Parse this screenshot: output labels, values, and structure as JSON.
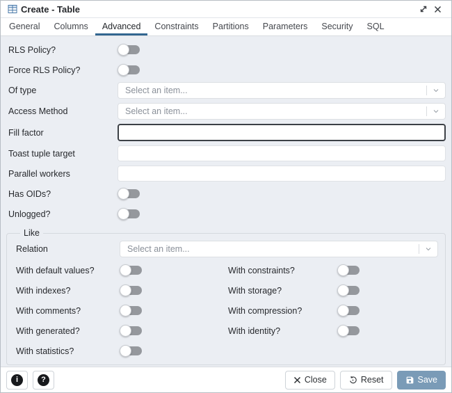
{
  "window": {
    "title": "Create - Table",
    "icon": "table-grid"
  },
  "tabs": {
    "items": [
      {
        "label": "General",
        "active": false
      },
      {
        "label": "Columns",
        "active": false
      },
      {
        "label": "Advanced",
        "active": true
      },
      {
        "label": "Constraints",
        "active": false
      },
      {
        "label": "Partitions",
        "active": false
      },
      {
        "label": "Parameters",
        "active": false
      },
      {
        "label": "Security",
        "active": false
      },
      {
        "label": "SQL",
        "active": false
      }
    ]
  },
  "form": {
    "rls_policy": {
      "label": "RLS Policy?",
      "type": "toggle",
      "value": false
    },
    "force_rls_policy": {
      "label": "Force RLS Policy?",
      "type": "toggle",
      "value": false
    },
    "of_type": {
      "label": "Of type",
      "type": "select",
      "placeholder": "Select an item..."
    },
    "access_method": {
      "label": "Access Method",
      "type": "select",
      "placeholder": "Select an item..."
    },
    "fill_factor": {
      "label": "Fill factor",
      "type": "text",
      "value": "",
      "focused": true
    },
    "toast_tuple_target": {
      "label": "Toast tuple target",
      "type": "text",
      "value": ""
    },
    "parallel_workers": {
      "label": "Parallel workers",
      "type": "text",
      "value": ""
    },
    "has_oids": {
      "label": "Has OIDs?",
      "type": "toggle",
      "value": false
    },
    "unlogged": {
      "label": "Unlogged?",
      "type": "toggle",
      "value": false
    }
  },
  "like_section": {
    "legend": "Like",
    "relation": {
      "label": "Relation",
      "type": "select",
      "placeholder": "Select an item..."
    },
    "toggles": [
      {
        "label": "With default values?",
        "value": false
      },
      {
        "label": "With constraints?",
        "value": false
      },
      {
        "label": "With indexes?",
        "value": false
      },
      {
        "label": "With storage?",
        "value": false
      },
      {
        "label": "With comments?",
        "value": false
      },
      {
        "label": "With compression?",
        "value": false
      },
      {
        "label": "With generated?",
        "value": false
      },
      {
        "label": "With identity?",
        "value": false
      },
      {
        "label": "With statistics?",
        "value": false
      }
    ]
  },
  "footer": {
    "info_icon": "info",
    "help_icon": "help",
    "close_label": "Close",
    "reset_label": "Reset",
    "save_label": "Save",
    "save_enabled": false
  },
  "colors": {
    "accent": "#326690",
    "save_button_bg": "#7a9bb7",
    "toggle_off_track": "#95989d",
    "title_icon_blue": "#4878a8"
  }
}
